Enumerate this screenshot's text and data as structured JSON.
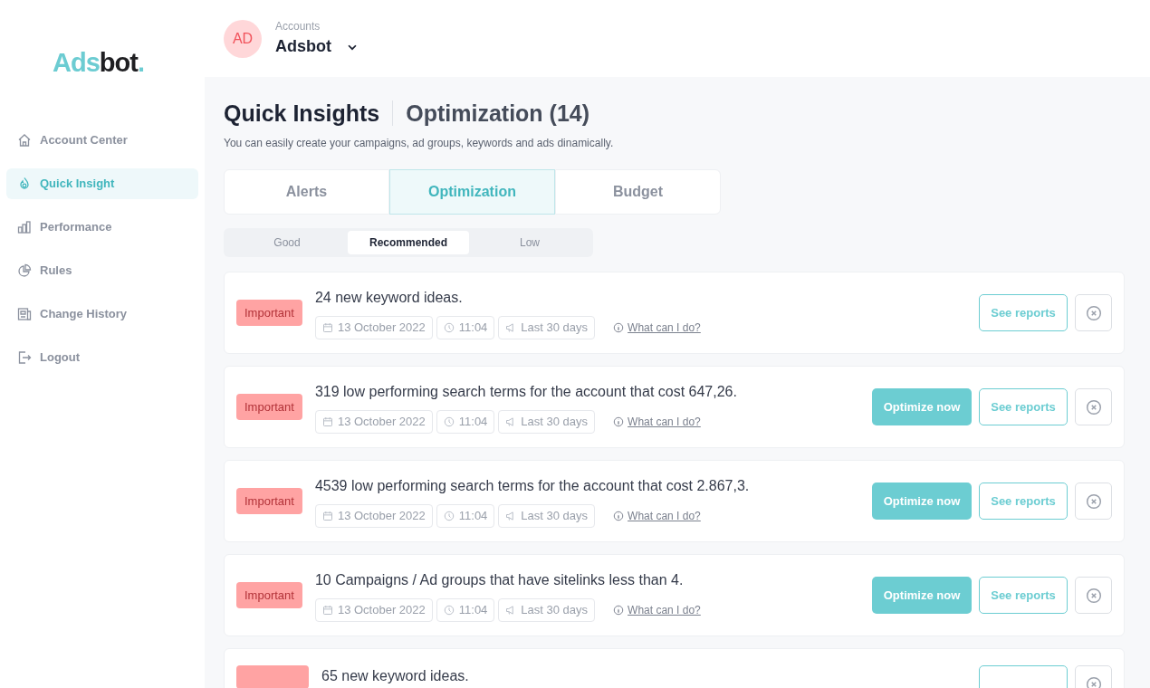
{
  "logo": {
    "part_1": "Ads",
    "part_2": "bot",
    "part_3": "."
  },
  "sidebar": {
    "items": [
      {
        "label": "Account Center",
        "selected": false
      },
      {
        "label": "Quick Insight",
        "selected": true
      },
      {
        "label": "Performance",
        "selected": false
      },
      {
        "label": "Rules",
        "selected": false
      },
      {
        "label": "Change History",
        "selected": false
      },
      {
        "label": "Logout",
        "selected": false
      }
    ]
  },
  "account": {
    "avatar": "AD",
    "caption": "Accounts",
    "name": "Adsbot"
  },
  "heading": {
    "title": "Quick Insights",
    "subtitle": "Optimization (14)",
    "description": "You can easily create your campaigns, ad groups, keywords and ads dinamically."
  },
  "tabs": [
    {
      "label": "Alerts",
      "selected": false
    },
    {
      "label": "Optimization",
      "selected": true
    },
    {
      "label": "Budget",
      "selected": false
    }
  ],
  "filters": [
    {
      "label": "Good",
      "selected": false
    },
    {
      "label": "Recommended",
      "selected": true
    },
    {
      "label": "Low",
      "selected": false
    }
  ],
  "insights": [
    {
      "badge": "Important",
      "title": "24 new keyword ideas.",
      "date": "13 October 2022",
      "time": "11:04",
      "period": "Last 30 days",
      "help": "What can I do?",
      "reports": "See reports"
    },
    {
      "badge": "Important",
      "title": "319 low performing search terms for the account that cost 647,26.",
      "date": "13 October 2022",
      "time": "11:04",
      "period": "Last 30 days",
      "help": "What can I do?",
      "optimize": "Optimize now",
      "reports": "See reports"
    },
    {
      "badge": "Important",
      "title": "4539 low performing search terms for the account that cost 2.867,3.",
      "date": "13 October 2022",
      "time": "11:04",
      "period": "Last 30 days",
      "help": "What can I do?",
      "optimize": "Optimize now",
      "reports": "See reports"
    },
    {
      "badge": "Important",
      "title": "10 Campaigns / Ad groups that have sitelinks less than 4.",
      "date": "13 October 2022",
      "time": "11:04",
      "period": "Last 30 days",
      "help": "What can I do?",
      "optimize": "Optimize now",
      "reports": "See reports"
    },
    {
      "title": "65 new keyword ideas."
    }
  ]
}
